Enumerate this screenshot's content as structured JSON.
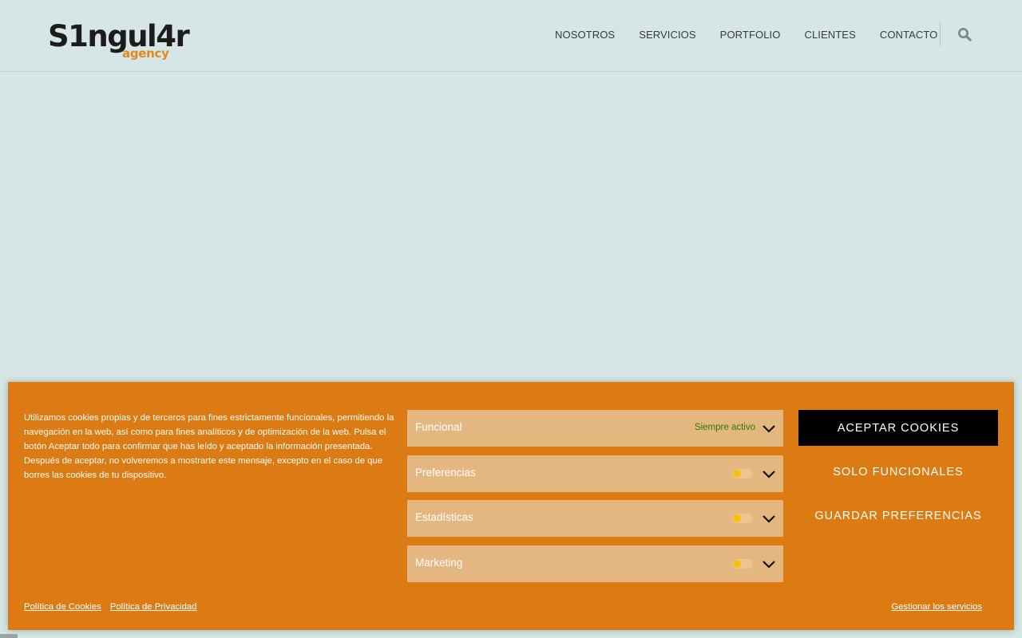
{
  "brand": {
    "logo_main": "S1ngul4r",
    "logo_sub": "agency",
    "accent_color": "#dc7b13"
  },
  "nav": {
    "items": [
      {
        "label": "NOSOTROS"
      },
      {
        "label": "SERVICIOS"
      },
      {
        "label": "PORTFOLIO"
      },
      {
        "label": "CLIENTES"
      },
      {
        "label": "CONTACTO"
      }
    ],
    "search_icon": "search-icon"
  },
  "cookie_banner": {
    "message": "Utilizamos cookies propias y de terceros para fines estrictamente funcionales, permitiendo la navegación en la web, así como para fines analíticos y de optimización de la web. Pulsa el botón Aceptar todo para confirmar que has leído y aceptado la información presentada. Después de aceptar, no volveremos a mostrarte este mensaje, excepto en el caso de que borres las cookies de tu dispositivo.",
    "categories": [
      {
        "label": "Funcional",
        "status": "Siempre activo"
      },
      {
        "label": "Preferencias",
        "enabled": false
      },
      {
        "label": "Estadísticas",
        "enabled": false
      },
      {
        "label": "Marketing",
        "enabled": false
      }
    ],
    "buttons": {
      "accept": "ACEPTAR COOKIES",
      "functional_only": "SOLO FUNCIONALES",
      "save_preferences": "GUARDAR PREFERENCIAS"
    },
    "links": {
      "cookie_policy": "Política de Cookies",
      "privacy_policy": "Política de Privacidad",
      "manage_services": "Gestionar los servicios"
    },
    "status_color": "#2b7a0b"
  }
}
